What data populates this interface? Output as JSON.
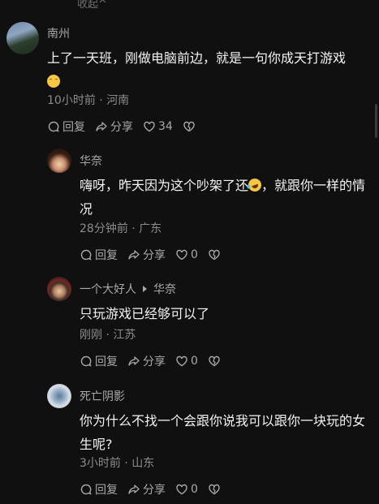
{
  "collapse_label": "收起^",
  "comments": [
    {
      "username": "南州",
      "text": "上了一天班，刚做电脑前边，就是一句你成天打游戏",
      "emoji": "smile",
      "time": "10小时前",
      "location": "河南",
      "reply_label": "回复",
      "share_label": "分享",
      "likes": "34"
    },
    {
      "username": "华奈",
      "text_before": "嗨呀，昨天因为这个吵架了还",
      "emoji": "laugh",
      "text_after": "，就跟你一样的情况",
      "time": "28分钟前",
      "location": "广东",
      "reply_label": "回复",
      "share_label": "分享",
      "likes": "0"
    },
    {
      "username": "一个大好人",
      "reply_to": "华奈",
      "text": "只玩游戏已经够可以了",
      "time": "刚刚",
      "location": "江苏",
      "reply_label": "回复",
      "share_label": "分享",
      "likes": "0"
    },
    {
      "username": "死亡阴影",
      "text": "你为什么不找一个会跟你说我可以跟你一块玩的女生呢?",
      "time": "3小时前",
      "location": "山东",
      "reply_label": "回复",
      "share_label": "分享",
      "likes": "0"
    }
  ],
  "colors": {
    "background": "#101010",
    "text": "#f2f2f2",
    "secondary": "#a9a9a9"
  }
}
